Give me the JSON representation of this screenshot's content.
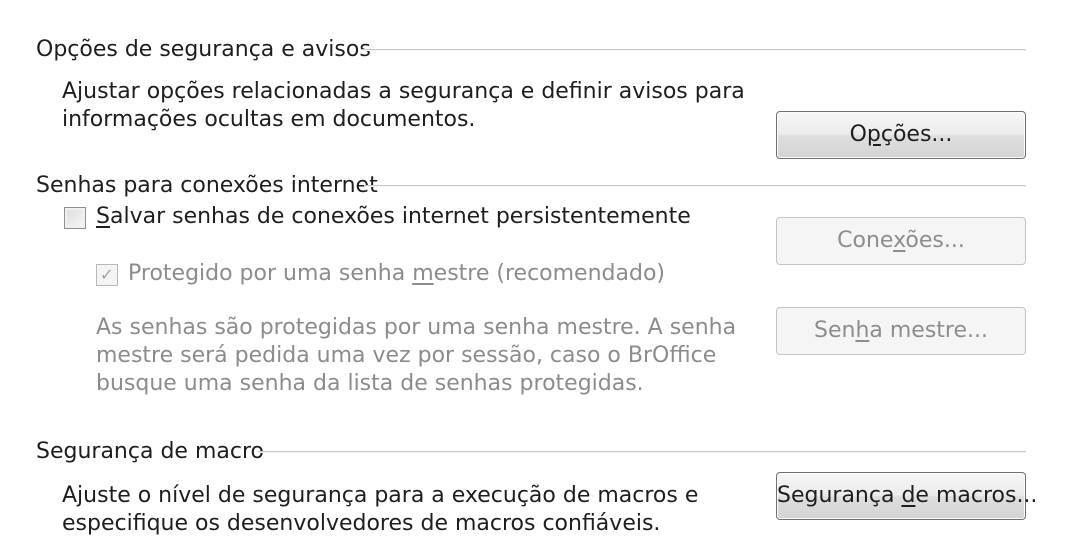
{
  "security": {
    "title": "Opções de segurança e avisos",
    "desc_line1": "Ajustar opções relacionadas a segurança e definir avisos para",
    "desc_line2": "informações ocultas em documentos.",
    "options_button": {
      "pre": "O",
      "key": "p",
      "post": "ções..."
    }
  },
  "passwords": {
    "title": "Senhas para conexões internet",
    "save_checkbox": {
      "checked": false,
      "pre": "",
      "key": "S",
      "post": "alvar senhas de conexões internet persistentemente"
    },
    "connections_button": {
      "pre": "Cone",
      "key": "x",
      "post": "ões..."
    },
    "master_checkbox": {
      "checked": true,
      "enabled": false,
      "pre": "Protegido por uma senha ",
      "key": "m",
      "post": "estre (recomendado)"
    },
    "master_desc": [
      "As senhas são protegidas por uma senha mestre. A senha",
      "mestre será pedida uma vez por sessão, caso o BrOffice",
      "busque uma senha da lista de senhas protegidas."
    ],
    "master_button": {
      "pre": "Sen",
      "key": "h",
      "post": "a mestre..."
    }
  },
  "macro": {
    "title": "Segurança de macro",
    "desc_line1": "Ajuste o nível de segurança para a execução de macros e",
    "desc_line2": "especifique os desenvolvedores de macros confiáveis.",
    "macro_button": {
      "pre": "Segurança ",
      "key": "d",
      "post": "e macros..."
    }
  },
  "icons": {
    "checkmark": "check-icon"
  }
}
